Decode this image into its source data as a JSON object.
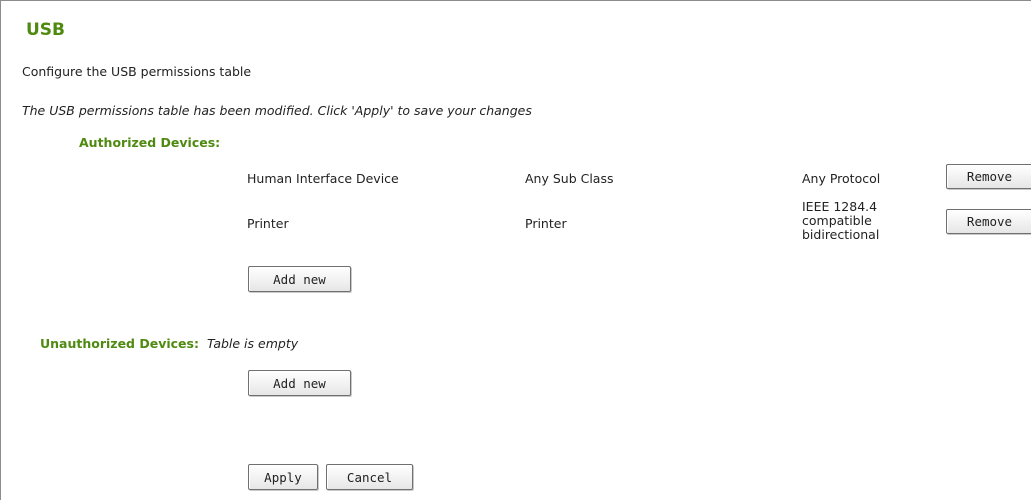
{
  "page": {
    "title": "USB",
    "subtitle": "Configure the USB permissions table",
    "notice": "The USB permissions table has been modified. Click 'Apply' to save your changes"
  },
  "authorized": {
    "label": "Authorized Devices:",
    "rows": [
      {
        "class": "Human Interface Device",
        "subclass": "Any Sub Class",
        "protocol": "Any Protocol",
        "remove_label": "Remove"
      },
      {
        "class": "Printer",
        "subclass": "Printer",
        "protocol_lines": [
          "IEEE 1284.4",
          "compatible",
          "bidirectional"
        ],
        "remove_label": "Remove"
      }
    ],
    "add_label": "Add new"
  },
  "unauthorized": {
    "label": "Unauthorized Devices:",
    "empty_text": "Table is empty",
    "add_label": "Add new"
  },
  "footer": {
    "apply_label": "Apply",
    "cancel_label": "Cancel"
  },
  "colors": {
    "accent_green": "#4f8a10"
  }
}
